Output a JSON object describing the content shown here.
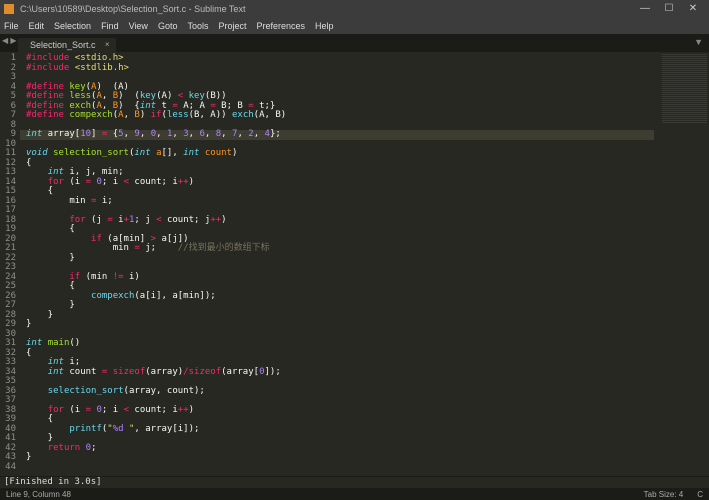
{
  "titlebar": {
    "path": "C:\\Users\\10589\\Desktop\\Selection_Sort.c - Sublime Text",
    "min": "—",
    "max": "☐",
    "close": "✕"
  },
  "menubar": [
    "File",
    "Edit",
    "Selection",
    "Find",
    "View",
    "Goto",
    "Tools",
    "Project",
    "Preferences",
    "Help"
  ],
  "tab": {
    "name": "Selection_Sort.c",
    "close": "×",
    "nav": "◀ ▶",
    "right_arrow": "▼"
  },
  "code": [
    {
      "n": 1,
      "h": "<span class='c-red'>#include</span> <span class='c-yellow'>&lt;stdio.h&gt;</span>"
    },
    {
      "n": 2,
      "h": "<span class='c-red'>#include</span> <span class='c-yellow'>&lt;stdlib.h&gt;</span>"
    },
    {
      "n": 3,
      "h": ""
    },
    {
      "n": 4,
      "h": "<span class='c-red'>#define</span> <span class='c-green'>key</span>(<span class='c-orange'>A</span>)  (A)"
    },
    {
      "n": 5,
      "h": "<span class='c-red'>#define</span> <span class='c-green'>less</span>(<span class='c-orange'>A</span>, <span class='c-orange'>B</span>)  (<span class='c-blue2'>key</span>(A) <span class='c-red'>&lt;</span> <span class='c-blue2'>key</span>(B))"
    },
    {
      "n": 6,
      "h": "<span class='c-red'>#define</span> <span class='c-green'>exch</span>(<span class='c-orange'>A</span>, <span class='c-orange'>B</span>)  {<span class='c-blue'>int</span> t <span class='c-red'>=</span> A; A <span class='c-red'>=</span> B; B <span class='c-red'>=</span> t;}"
    },
    {
      "n": 7,
      "h": "<span class='c-red'>#define</span> <span class='c-green'>compexch</span>(<span class='c-orange'>A</span>, <span class='c-orange'>B</span>) <span class='c-red'>if</span>(<span class='c-blue2'>less</span>(B, A)) <span class='c-blue2'>exch</span>(A, B)"
    },
    {
      "n": 8,
      "h": ""
    },
    {
      "n": 9,
      "cur": true,
      "h": "<span class='c-blue'>int</span> array[<span class='c-purple'>10</span>] <span class='c-red'>=</span> {<span class='c-purple'>5</span>, <span class='c-purple'>9</span>, <span class='c-purple'>0</span>, <span class='c-purple'>1</span>, <span class='c-purple'>3</span>, <span class='c-purple'>6</span>, <span class='c-purple'>8</span>, <span class='c-purple'>7</span>, <span class='c-purple'>2</span>, <span class='c-purple'>4</span>};"
    },
    {
      "n": 10,
      "h": ""
    },
    {
      "n": 11,
      "h": "<span class='c-blue'>void</span> <span class='c-green'>selection_sort</span>(<span class='c-blue'>int</span> <span class='c-orange'>a</span>[], <span class='c-blue'>int</span> <span class='c-orange'>count</span>)"
    },
    {
      "n": 12,
      "h": "{"
    },
    {
      "n": 13,
      "h": "    <span class='c-blue'>int</span> i, j, min;"
    },
    {
      "n": 14,
      "h": "    <span class='c-red'>for</span> (i <span class='c-red'>=</span> <span class='c-purple'>0</span>; i <span class='c-red'>&lt;</span> count; i<span class='c-red'>++</span>)"
    },
    {
      "n": 15,
      "h": "    {"
    },
    {
      "n": 16,
      "h": "        min <span class='c-red'>=</span> i;"
    },
    {
      "n": 17,
      "h": ""
    },
    {
      "n": 18,
      "h": "        <span class='c-red'>for</span> (j <span class='c-red'>=</span> i<span class='c-red'>+</span><span class='c-purple'>1</span>; j <span class='c-red'>&lt;</span> count; j<span class='c-red'>++</span>)"
    },
    {
      "n": 19,
      "h": "        {"
    },
    {
      "n": 20,
      "h": "            <span class='c-red'>if</span> (a[min] <span class='c-red'>&gt;</span> a[j])"
    },
    {
      "n": 21,
      "h": "                min <span class='c-red'>=</span> j;    <span class='c-gray'>//找到最小的数组下标</span>"
    },
    {
      "n": 22,
      "h": "        }"
    },
    {
      "n": 23,
      "h": ""
    },
    {
      "n": 24,
      "h": "        <span class='c-red'>if</span> (min <span class='c-red'>!=</span> i)"
    },
    {
      "n": 25,
      "h": "        {"
    },
    {
      "n": 26,
      "h": "            <span class='c-blue2'>compexch</span>(a[i], a[min]);"
    },
    {
      "n": 27,
      "h": "        }"
    },
    {
      "n": 28,
      "h": "    }"
    },
    {
      "n": 29,
      "h": "}"
    },
    {
      "n": 30,
      "h": ""
    },
    {
      "n": 31,
      "h": "<span class='c-blue'>int</span> <span class='c-green'>main</span>()"
    },
    {
      "n": 32,
      "h": "{"
    },
    {
      "n": 33,
      "h": "    <span class='c-blue'>int</span> i;"
    },
    {
      "n": 34,
      "h": "    <span class='c-blue'>int</span> count <span class='c-red'>=</span> <span class='c-red'>sizeof</span>(array)<span class='c-red'>/</span><span class='c-red'>sizeof</span>(array[<span class='c-purple'>0</span>]);"
    },
    {
      "n": 35,
      "h": ""
    },
    {
      "n": 36,
      "h": "    <span class='c-blue2'>selection_sort</span>(array, count);"
    },
    {
      "n": 37,
      "h": ""
    },
    {
      "n": 38,
      "h": "    <span class='c-red'>for</span> (i <span class='c-red'>=</span> <span class='c-purple'>0</span>; i <span class='c-red'>&lt;</span> count; i<span class='c-red'>++</span>)"
    },
    {
      "n": 39,
      "h": "    {"
    },
    {
      "n": 40,
      "h": "        <span class='c-blue2'>printf</span>(<span class='c-yellow'>\"</span><span class='c-purple'>%d</span><span class='c-yellow'> \"</span>, array[i]);"
    },
    {
      "n": 41,
      "h": "    }"
    },
    {
      "n": 42,
      "h": "    <span class='c-red'>return</span> <span class='c-purple'>0</span>;"
    },
    {
      "n": 43,
      "h": "}"
    },
    {
      "n": 44,
      "h": ""
    }
  ],
  "build": "[Finished in 3.0s]",
  "status": {
    "pos": "Line 9, Column 48",
    "tab": "Tab Size: 4",
    "lang": "C"
  }
}
